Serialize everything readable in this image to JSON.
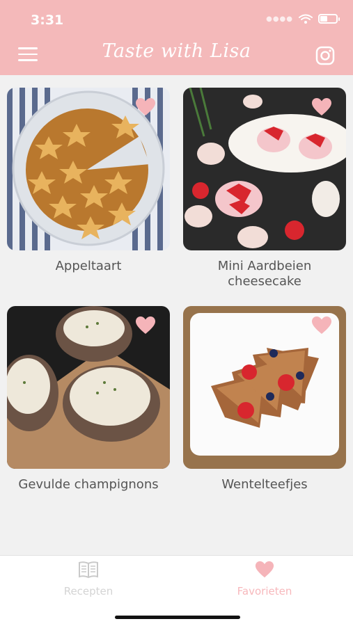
{
  "status_bar": {
    "time": "3:31"
  },
  "header": {
    "title": "Taste with Lisa",
    "menu_icon": "hamburger-menu-icon",
    "instagram_icon": "instagram-icon"
  },
  "recipes": [
    {
      "name": "Appeltaart",
      "favorite": true,
      "image": "apple-pie-photo"
    },
    {
      "name": "Mini Aardbeien cheesecake",
      "favorite": true,
      "image": "strawberry-cheesecake-photo"
    },
    {
      "name": "Gevulde champignons",
      "favorite": true,
      "image": "stuffed-mushrooms-photo"
    },
    {
      "name": "Wentelteefjes",
      "favorite": true,
      "image": "french-toast-photo"
    }
  ],
  "tabs": [
    {
      "label": "Recepten",
      "icon": "book-icon",
      "active": false
    },
    {
      "label": "Favorieten",
      "icon": "heart-icon",
      "active": true
    }
  ],
  "colors": {
    "brand": "#f4b9ba",
    "active_tab": "#f7b8bc",
    "inactive_tab": "#d4d4d4",
    "heart": "#f5b4b9"
  }
}
